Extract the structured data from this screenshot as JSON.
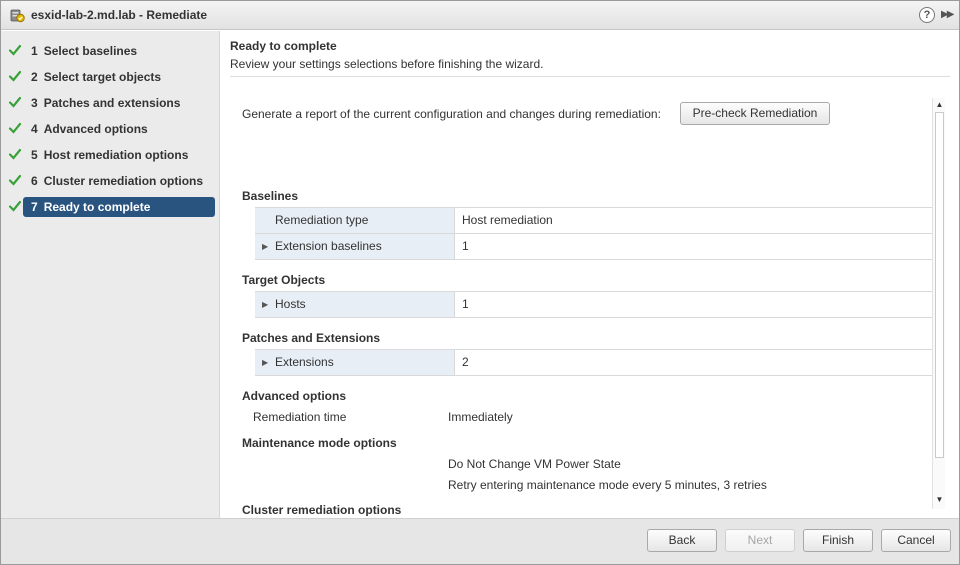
{
  "window": {
    "title": "esxid-lab-2.md.lab - Remediate",
    "help_glyph": "?",
    "expand_glyph": "▶▶"
  },
  "steps": [
    {
      "num": "1",
      "label": "Select baselines",
      "done": true,
      "active": false
    },
    {
      "num": "2",
      "label": "Select target objects",
      "done": true,
      "active": false
    },
    {
      "num": "3",
      "label": "Patches and extensions",
      "done": true,
      "active": false
    },
    {
      "num": "4",
      "label": "Advanced options",
      "done": true,
      "active": false
    },
    {
      "num": "5",
      "label": "Host remediation options",
      "done": true,
      "active": false
    },
    {
      "num": "6",
      "label": "Cluster remediation options",
      "done": true,
      "active": false
    },
    {
      "num": "7",
      "label": "Ready to complete",
      "done": true,
      "active": true
    }
  ],
  "main": {
    "title": "Ready to complete",
    "subtitle": "Review your settings selections before finishing the wizard.",
    "precheck_text": "Generate a report of the current configuration and changes during remediation:",
    "precheck_button": "Pre-check Remediation"
  },
  "sections": {
    "baselines": {
      "title": "Baselines",
      "rows": [
        {
          "key": "Remediation type",
          "value": "Host remediation",
          "expandable": false
        },
        {
          "key": "Extension baselines",
          "value": "1",
          "expandable": true
        }
      ]
    },
    "target_objects": {
      "title": "Target Objects",
      "rows": [
        {
          "key": "Hosts",
          "value": "1",
          "expandable": true
        }
      ]
    },
    "patches": {
      "title": "Patches and Extensions",
      "rows": [
        {
          "key": "Extensions",
          "value": "2",
          "expandable": true
        }
      ]
    },
    "advanced": {
      "title": "Advanced options",
      "remediation_time_label": "Remediation time",
      "remediation_time_value": "Immediately"
    },
    "maintenance": {
      "title": "Maintenance mode options",
      "line1": "Do Not Change VM Power State",
      "line2": "Retry entering maintenance mode every 5 minutes, 3 retries"
    },
    "cluster": {
      "title": "Cluster remediation options"
    }
  },
  "footer": {
    "back": "Back",
    "next": "Next",
    "finish": "Finish",
    "cancel": "Cancel"
  },
  "colors": {
    "active_step": "#2a5480",
    "check_green": "#3aa13a",
    "key_cell": "#e8eef6"
  }
}
